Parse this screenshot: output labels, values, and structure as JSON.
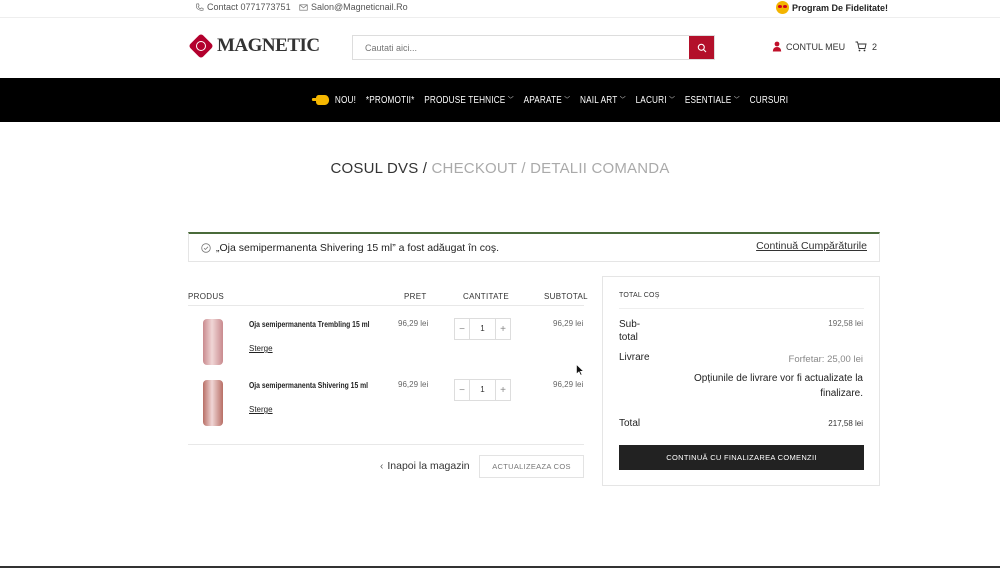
{
  "topbar": {
    "contact": "Contact 0771773751",
    "email": "Salon@Magneticnail.Ro",
    "loyalty": "Program De Fidelitate!"
  },
  "header": {
    "logo_text": "MAGNETIC",
    "search_placeholder": "Cautati aici...",
    "account_label": "CONTUL MEU",
    "cart_count": "2"
  },
  "nav": {
    "items": [
      {
        "label": "NOU!",
        "dropdown": false
      },
      {
        "label": "*PROMOTII*",
        "dropdown": false
      },
      {
        "label": "PRODUSE TEHNICE",
        "dropdown": true
      },
      {
        "label": "APARATE",
        "dropdown": true
      },
      {
        "label": "NAIL ART",
        "dropdown": true
      },
      {
        "label": "LACURI",
        "dropdown": true
      },
      {
        "label": "ESENTIALE",
        "dropdown": true
      },
      {
        "label": "CURSURI",
        "dropdown": false
      }
    ]
  },
  "breadcrumb": {
    "current": "COSUL DVS /",
    "rest": "CHECKOUT / DETALII COMANDA"
  },
  "notice": {
    "message": "„Oja semipermanenta Shivering 15 ml” a fost adăugat în coş.",
    "continue": "Continuă Cumpărăturile"
  },
  "cart": {
    "headers": {
      "product": "PRODUS",
      "price": "PRET",
      "quantity": "CANTITATE",
      "subtotal": "SUBTOTAL"
    },
    "items": [
      {
        "name": "Oja semipermanenta Trembling 15 ml",
        "remove": "Sterge",
        "price": "96,29 lei",
        "qty": "1",
        "subtotal": "96,29 lei",
        "color": "#c98a8e"
      },
      {
        "name": "Oja semipermanenta Shivering 15 ml",
        "remove": "Sterge",
        "price": "96,29 lei",
        "qty": "1",
        "subtotal": "96,29 lei",
        "color": "#b86f66"
      }
    ],
    "back_label": "Inapoi la magazin",
    "update_label": "ACTUALIZEAZA COS"
  },
  "totals": {
    "title": "TOTAL COȘ",
    "subtotal_label": "Sub-total",
    "subtotal_value": "192,58 lei",
    "shipping_label": "Livrare",
    "shipping_value": "Forfetar: 25,00 lei",
    "shipping_note": "Opțiunile de livrare vor fi actualizate la finalizare.",
    "total_label": "Total",
    "total_value": "217,58 lei",
    "checkout_label": "CONTINUĂ CU FINALIZAREA COMENZII"
  },
  "colors": {
    "accent": "#b3102a",
    "nav_bg": "#000000",
    "notice_border": "#4a6b3a"
  }
}
